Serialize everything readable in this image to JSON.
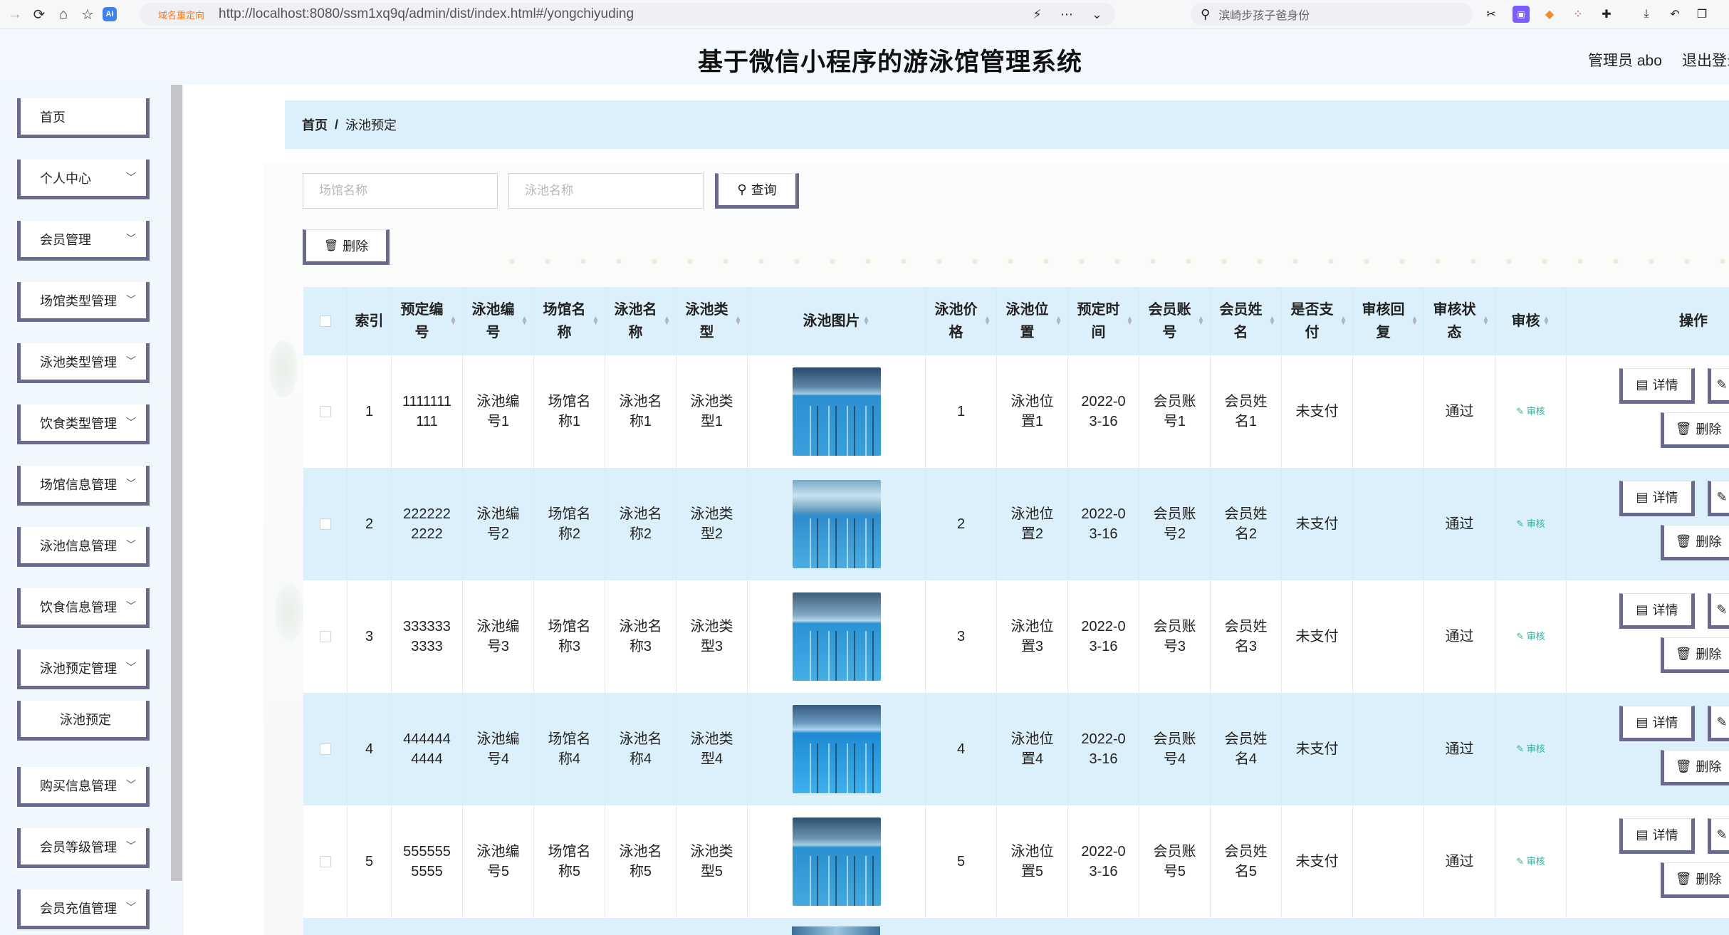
{
  "browser": {
    "redirect_label": "域名重定向",
    "url": "http://localhost:8080/ssm1xq9q/admin/dist/index.html#/yongchiyuding",
    "search_text": "滨崎步孩子爸身份"
  },
  "header": {
    "title": "基于微信小程序的游泳馆管理系统",
    "user": "管理员 abo",
    "logout": "退出登录"
  },
  "sidebar": {
    "items": [
      {
        "label": "首页"
      },
      {
        "label": "个人中心"
      },
      {
        "label": "会员管理"
      },
      {
        "label": "场馆类型管理"
      },
      {
        "label": "泳池类型管理"
      },
      {
        "label": "饮食类型管理"
      },
      {
        "label": "场馆信息管理"
      },
      {
        "label": "泳池信息管理"
      },
      {
        "label": "饮食信息管理"
      },
      {
        "label": "泳池预定管理"
      },
      {
        "label": "泳池预定"
      },
      {
        "label": "购买信息管理"
      },
      {
        "label": "会员等级管理"
      },
      {
        "label": "会员充值管理"
      }
    ]
  },
  "breadcrumb": {
    "home": "首页",
    "sep": "/",
    "current": "泳池预定"
  },
  "search": {
    "venue_placeholder": "场馆名称",
    "pool_placeholder": "泳池名称",
    "query_label": "查询",
    "delete_label": "删除"
  },
  "table": {
    "headers": {
      "index": "索引",
      "booking_no": "预定编号",
      "pool_no": "泳池编号",
      "venue_name": "场馆名称",
      "pool_name": "泳池名称",
      "pool_type": "泳池类型",
      "pool_image": "泳池图片",
      "pool_price": "泳池价格",
      "pool_location": "泳池位置",
      "booking_time": "预定时间",
      "member_account": "会员账号",
      "member_name": "会员姓名",
      "paid": "是否支付",
      "review_reply": "审核回复",
      "review_status": "审核状态",
      "review": "审核",
      "actions": "操作"
    },
    "detail_label": "详情",
    "delete_label": "删除",
    "audit_label": "审核",
    "rows": [
      {
        "index": "1",
        "booking_no": "1111111111",
        "pool_no": "泳池编号1",
        "venue_name": "场馆名称1",
        "pool_name": "泳池名称1",
        "pool_type": "泳池类型1",
        "pool_price": "1",
        "pool_location": "泳池位置1",
        "booking_time": "2022-03-16",
        "member_account": "会员账号1",
        "member_name": "会员姓名1",
        "paid": "未支付",
        "review_reply": "",
        "review_status": "通过"
      },
      {
        "index": "2",
        "booking_no": "2222222222",
        "pool_no": "泳池编号2",
        "venue_name": "场馆名称2",
        "pool_name": "泳池名称2",
        "pool_type": "泳池类型2",
        "pool_price": "2",
        "pool_location": "泳池位置2",
        "booking_time": "2022-03-16",
        "member_account": "会员账号2",
        "member_name": "会员姓名2",
        "paid": "未支付",
        "review_reply": "",
        "review_status": "通过"
      },
      {
        "index": "3",
        "booking_no": "3333333333",
        "pool_no": "泳池编号3",
        "venue_name": "场馆名称3",
        "pool_name": "泳池名称3",
        "pool_type": "泳池类型3",
        "pool_price": "3",
        "pool_location": "泳池位置3",
        "booking_time": "2022-03-16",
        "member_account": "会员账号3",
        "member_name": "会员姓名3",
        "paid": "未支付",
        "review_reply": "",
        "review_status": "通过"
      },
      {
        "index": "4",
        "booking_no": "4444444444",
        "pool_no": "泳池编号4",
        "venue_name": "场馆名称4",
        "pool_name": "泳池名称4",
        "pool_type": "泳池类型4",
        "pool_price": "4",
        "pool_location": "泳池位置4",
        "booking_time": "2022-03-16",
        "member_account": "会员账号4",
        "member_name": "会员姓名4",
        "paid": "未支付",
        "review_reply": "",
        "review_status": "通过"
      },
      {
        "index": "5",
        "booking_no": "5555555555",
        "pool_no": "泳池编号5",
        "venue_name": "场馆名称5",
        "pool_name": "泳池名称5",
        "pool_type": "泳池类型5",
        "pool_price": "5",
        "pool_location": "泳池位置5",
        "booking_time": "2022-03-16",
        "member_account": "会员账号5",
        "member_name": "会员姓名5",
        "paid": "未支付",
        "review_reply": "",
        "review_status": "通过"
      }
    ]
  },
  "colors": {
    "accent": "#6a6a8e",
    "header_bg": "#f2f8fd",
    "table_header_bg": "#dcf0fb",
    "alt_row_bg": "#dcf0fb",
    "audit_color": "#2bb5a0"
  }
}
